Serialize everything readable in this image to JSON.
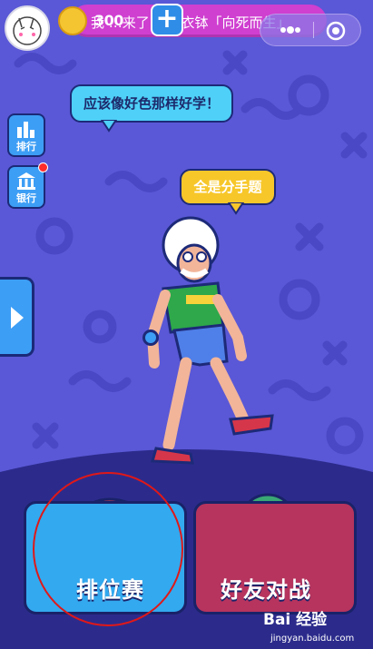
{
  "top_bar": {
    "marquee_text": "我 …来了 格尔衣钵「向死而生」",
    "coin_count": "300",
    "add_coins_symbol": "+"
  },
  "sidebar": {
    "ranking_label": "排行",
    "bank_label": "银行",
    "bank_has_notification": true
  },
  "speech_bubbles": {
    "blue": "应该像好色那样好学！",
    "yellow": "全是分手题"
  },
  "modes": {
    "ranked_label": "排位赛",
    "friend_label": "好友对战"
  },
  "watermark": {
    "brand": "Bai 经验",
    "url": "jingyan.baidu.com"
  },
  "colors": {
    "background": "#5a58d6",
    "accent_blue": "#33a9ef",
    "accent_red": "#b6345e",
    "highlight_circle": "#e01818",
    "coin": "#f4c531"
  }
}
